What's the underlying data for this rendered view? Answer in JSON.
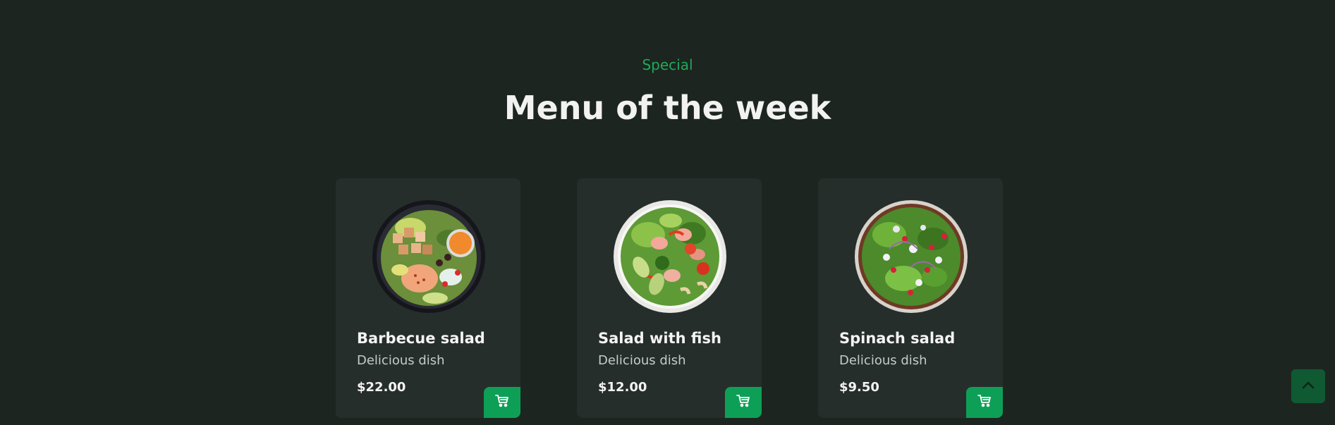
{
  "header": {
    "subtitle": "Special",
    "title": "Menu of the week"
  },
  "colors": {
    "background": "#1d2520",
    "card": "#262e2b",
    "accent": "#0e9f56",
    "subtitle": "#1faa59"
  },
  "menu": {
    "items": [
      {
        "name": "Barbecue salad",
        "description": "Delicious dish",
        "price": "$22.00",
        "image_icon": "barbecue-salad-image",
        "cart_icon": "cart-icon"
      },
      {
        "name": "Salad with fish",
        "description": "Delicious dish",
        "price": "$12.00",
        "image_icon": "fish-salad-image",
        "cart_icon": "cart-icon"
      },
      {
        "name": "Spinach salad",
        "description": "Delicious dish",
        "price": "$9.50",
        "image_icon": "spinach-salad-image",
        "cart_icon": "cart-icon"
      }
    ]
  },
  "scroll_up": {
    "icon": "chevron-up-icon"
  }
}
